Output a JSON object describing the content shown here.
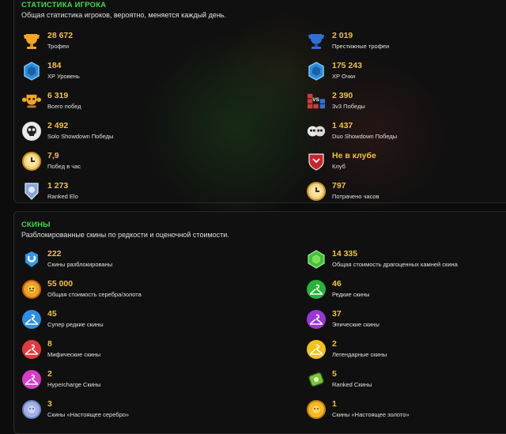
{
  "stats": {
    "title": "СТАТИСТИКА ИГРОКА",
    "subtitle": "Общая статистика игроков, вероятно, меняется каждый день.",
    "items": [
      {
        "value": "28 672",
        "label": "Трофеи",
        "icon": "trophy-icon"
      },
      {
        "value": "2 019",
        "label": "Престижные трофеи",
        "icon": "prestige-trophy-icon"
      },
      {
        "value": "184",
        "label": "XP Уровень",
        "icon": "xp-level-icon"
      },
      {
        "value": "175 243",
        "label": "XP Очки",
        "icon": "xp-points-icon"
      },
      {
        "value": "6 319",
        "label": "Всего побед",
        "icon": "total-wins-icon"
      },
      {
        "value": "2 390",
        "label": "3v3 Победы",
        "icon": "3v3-wins-icon"
      },
      {
        "value": "2 492",
        "label": "Solo Showdown Победы",
        "icon": "solo-showdown-icon"
      },
      {
        "value": "1 437",
        "label": "Duo Showdown Победы",
        "icon": "duo-showdown-icon"
      },
      {
        "value": "7,9",
        "label": "Побед в час",
        "icon": "wins-per-hour-icon"
      },
      {
        "value": "Не в клубе",
        "label": "Клуб",
        "icon": "club-icon"
      },
      {
        "value": "1 273",
        "label": "Ranked Elo",
        "icon": "ranked-elo-icon"
      },
      {
        "value": "797",
        "label": "Потрачено часов",
        "icon": "hours-spent-icon"
      }
    ]
  },
  "skins": {
    "title": "СКИНЫ",
    "subtitle": "Разблокированные скины по редкости и оценочной стоимости.",
    "items": [
      {
        "value": "222",
        "label": "Скины разблокированы",
        "icon": "skins-unlocked-icon"
      },
      {
        "value": "14 335",
        "label": "Общая стоимость драгоценных камней скина",
        "icon": "gem-icon"
      },
      {
        "value": "55 000",
        "label": "Общая стоимость серебра/золота",
        "icon": "coin-icon"
      },
      {
        "value": "46",
        "label": "Редкие скины",
        "icon": "rare-skin-icon"
      },
      {
        "value": "45",
        "label": "Супер редкие скины",
        "icon": "super-rare-skin-icon"
      },
      {
        "value": "37",
        "label": "Эпические скины",
        "icon": "epic-skin-icon"
      },
      {
        "value": "8",
        "label": "Мифические скины",
        "icon": "mythic-skin-icon"
      },
      {
        "value": "2",
        "label": "Легендарные скины",
        "icon": "legendary-skin-icon"
      },
      {
        "value": "2",
        "label": "Hypercharge Скины",
        "icon": "hypercharge-skin-icon"
      },
      {
        "value": "5",
        "label": "Ranked Скины",
        "icon": "ranked-skin-icon"
      },
      {
        "value": "3",
        "label": "Скины «Настоящее серебро»",
        "icon": "true-silver-skin-icon"
      },
      {
        "value": "1",
        "label": "Скины «Настоящее золото»",
        "icon": "true-gold-skin-icon"
      }
    ]
  },
  "colors": {
    "accent": "#43d84a",
    "value": "#f2c23a",
    "background": "#0c0c0c"
  }
}
